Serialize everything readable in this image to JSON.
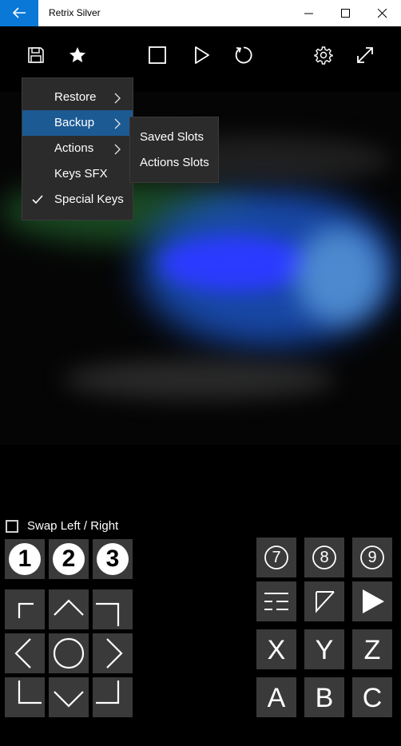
{
  "window": {
    "title": "Retrix Silver"
  },
  "toolbar": {
    "icons": [
      "save-icon",
      "star-icon",
      "stop-icon",
      "play-icon",
      "reset-icon",
      "settings-icon",
      "fullscreen-icon"
    ]
  },
  "menu": {
    "items": [
      {
        "label": "Restore",
        "has_submenu": true
      },
      {
        "label": "Backup",
        "has_submenu": true,
        "selected": true
      },
      {
        "label": "Actions",
        "has_submenu": true
      },
      {
        "label": "Keys SFX",
        "has_submenu": false
      },
      {
        "label": "Special Keys",
        "has_submenu": false,
        "checked": true
      }
    ]
  },
  "submenu": {
    "items": [
      {
        "label": "Saved Slots"
      },
      {
        "label": "Actions Slots"
      }
    ]
  },
  "controls": {
    "swap_label": "Swap Left / Right",
    "swap_checked": false,
    "number_keys_left": [
      "1",
      "2",
      "3"
    ],
    "number_keys_right": [
      "7",
      "8",
      "9"
    ],
    "face_row1": [
      "X",
      "Y",
      "Z"
    ],
    "face_row2": [
      "A",
      "B",
      "C"
    ]
  },
  "colors": {
    "accent": "#0a78d7",
    "menu_selected": "#1c5a94",
    "button_bg": "#3a3a3a"
  }
}
